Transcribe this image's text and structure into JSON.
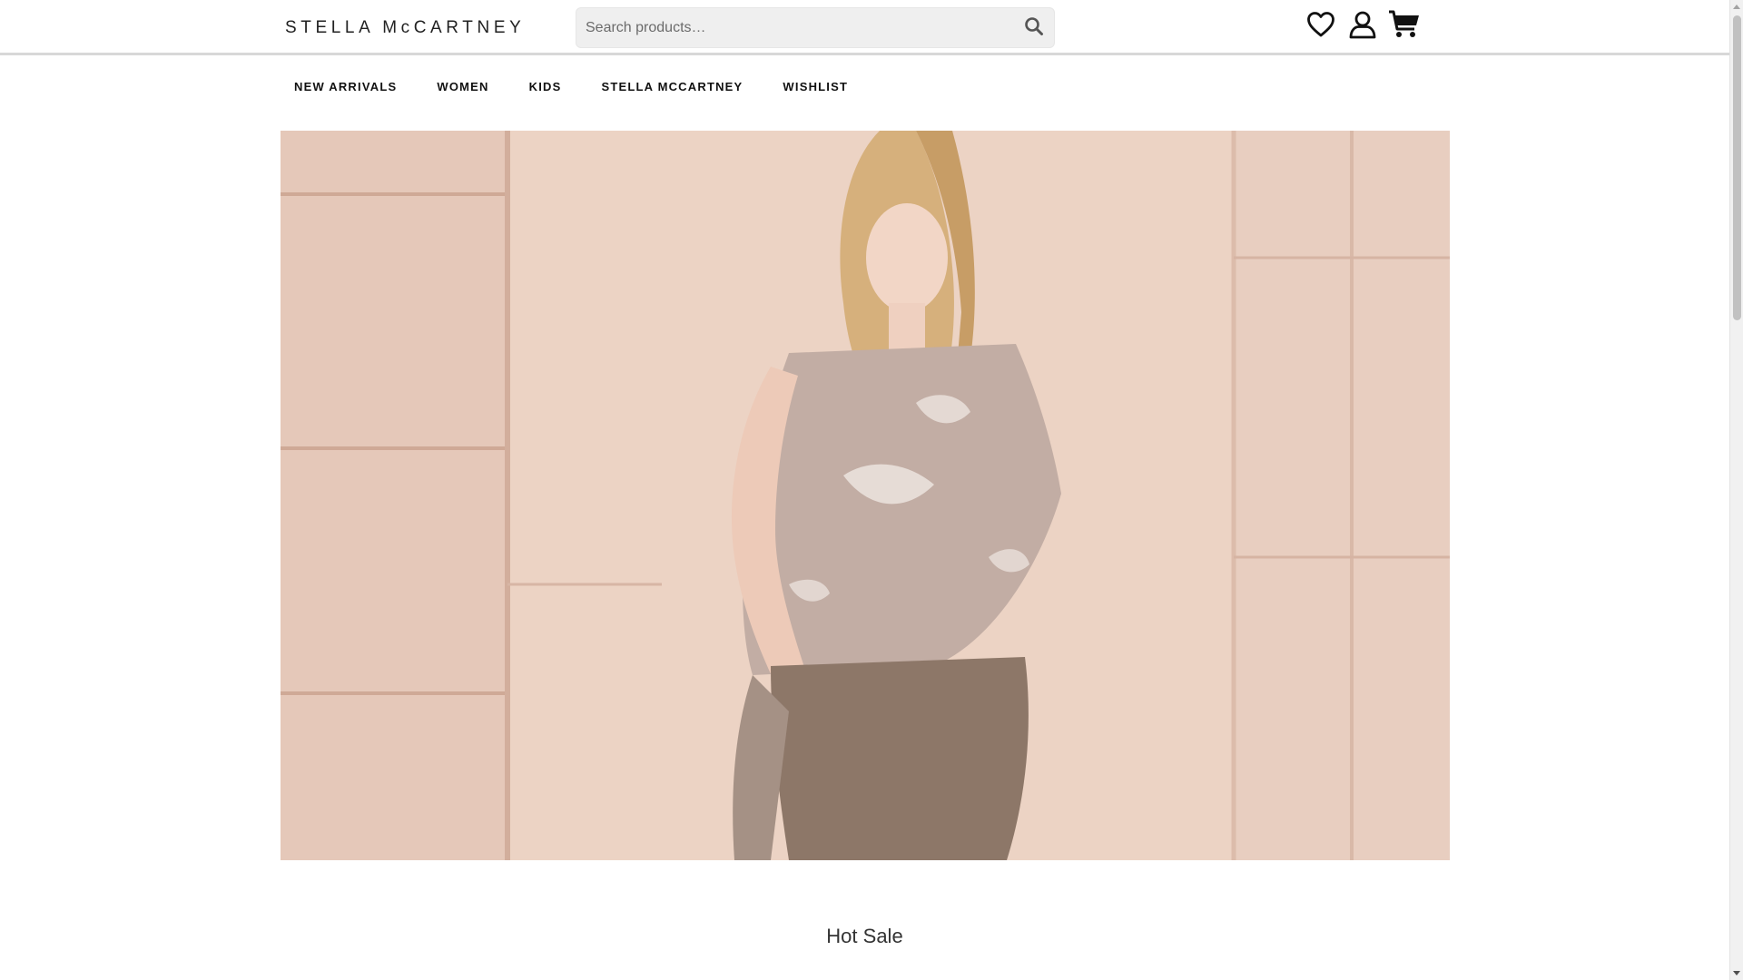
{
  "header": {
    "logo_text": "STELLA McCARTNEY",
    "search": {
      "placeholder": "Search products…",
      "value": ""
    },
    "icons": [
      "heart-icon",
      "user-icon",
      "cart-icon"
    ]
  },
  "nav": {
    "items": [
      {
        "label": "NEW ARRIVALS"
      },
      {
        "label": "WOMEN"
      },
      {
        "label": "KIDS"
      },
      {
        "label": "STELLA MCCARTNEY"
      },
      {
        "label": "WISHLIST"
      }
    ]
  },
  "main": {
    "hero": {
      "image_desc": "Model in pale printed sleeveless top and taupe trousers against a stone wall"
    },
    "section_title": "Hot Sale"
  },
  "colors": {
    "text": "#111111",
    "search_bg": "#efefef",
    "divider": "#d8d8d8",
    "hero_bg": "#ecd2c2"
  }
}
